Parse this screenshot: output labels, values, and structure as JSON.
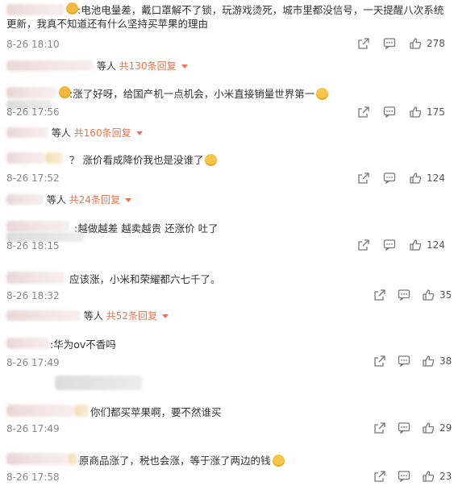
{
  "comments": [
    {
      "text": ":电池电量差，戴口罩解不了锁，玩游戏烫死，城市里都没信号，一天提醒八次系统更新，我真不知道还有什么坚持买苹果的理由",
      "time": "8-26 18:10",
      "likes": "278",
      "replies": {
        "who": "等人",
        "more": "共130条回复"
      }
    },
    {
      "text": ":涨了好呀，给国产机一点机会，小米直接销量世界第一",
      "time": "8-26 17:56",
      "likes": "175",
      "replies": {
        "who": "等人",
        "more": "共160条回复"
      }
    },
    {
      "text": "？ 涨价看成降价我也是没谁了",
      "time": "8-26 17:52",
      "likes": "124",
      "replies": {
        "who": "等人",
        "more": "共24条回复"
      }
    },
    {
      "text": ":越做越差 越卖越贵 还涨价 吐了",
      "time": "8-26 18:15",
      "likes": "124"
    },
    {
      "text": "应该涨，小米和荣耀都六七千了。",
      "time": "8-26 18:32",
      "likes": "35",
      "replies": {
        "who": "等人",
        "more": "共52条回复"
      }
    },
    {
      "text": ":华为ov不香吗",
      "time": "8-26 17:49",
      "likes": "38"
    },
    {
      "text": "你们都买苹果啊，要不然谁买",
      "time": "8-26 17:49",
      "likes": "29"
    },
    {
      "text": "原商品涨了，税也会涨，等于涨了两边的钱",
      "time": "8-26 17:58",
      "likes": "23"
    }
  ],
  "icons": {
    "share": "share-icon",
    "comment": "comment-icon",
    "like": "thumbs-up-icon",
    "emoji": "emoji-icon"
  },
  "colors": {
    "link": "#eb7350",
    "meta": "#888888",
    "text": "#333333"
  }
}
